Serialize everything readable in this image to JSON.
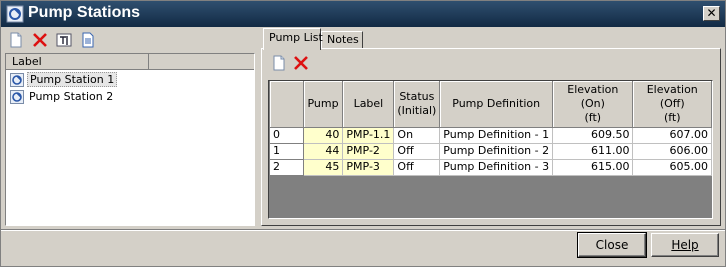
{
  "window": {
    "title": "Pump Stations",
    "close_glyph": "✕",
    "title_icon": "pump-station-icon"
  },
  "left_toolbar": {
    "buttons": [
      {
        "name": "new-icon"
      },
      {
        "name": "delete-icon"
      },
      {
        "name": "rename-icon"
      },
      {
        "name": "report-icon"
      }
    ]
  },
  "tree": {
    "column_header": "Label",
    "items": [
      {
        "label": "Pump Station 1",
        "selected": true
      },
      {
        "label": "Pump Station 2",
        "selected": false
      }
    ]
  },
  "tabs": [
    {
      "label": "Pump List",
      "active": true
    },
    {
      "label": "Notes",
      "active": false
    }
  ],
  "grid_toolbar": {
    "buttons": [
      {
        "name": "new-icon"
      },
      {
        "name": "delete-icon"
      }
    ]
  },
  "grid": {
    "headers": [
      "",
      "Pump",
      "Label",
      "Status\n(Initial)",
      "Pump Definition",
      "Elevation (On)\n(ft)",
      "Elevation (Off)\n(ft)"
    ],
    "rows": [
      {
        "index": "0",
        "pump": "40",
        "label": "PMP-1.1",
        "status": "On",
        "definition": "Pump Definition - 1",
        "elev_on": "609.50",
        "elev_off": "607.00"
      },
      {
        "index": "1",
        "pump": "44",
        "label": "PMP-2",
        "status": "Off",
        "definition": "Pump Definition - 2",
        "elev_on": "611.00",
        "elev_off": "606.00"
      },
      {
        "index": "2",
        "pump": "45",
        "label": "PMP-3",
        "status": "Off",
        "definition": "Pump Definition - 3",
        "elev_on": "615.00",
        "elev_off": "605.00"
      }
    ]
  },
  "buttons": {
    "close": "Close",
    "help": "Help"
  }
}
